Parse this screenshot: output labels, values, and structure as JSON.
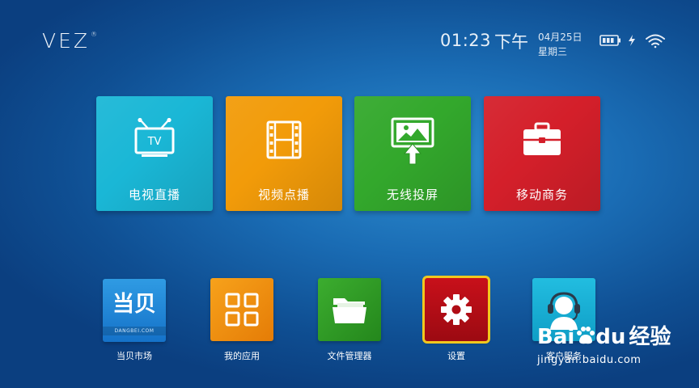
{
  "header": {
    "logo_text": "VEZ",
    "logo_mark": "®",
    "time": "01:23",
    "ampm": "下午",
    "date": "04月25日",
    "weekday": "星期三",
    "status_icons": [
      "battery-icon",
      "charging-icon",
      "wifi-icon"
    ]
  },
  "tiles": [
    {
      "label": "电视直播",
      "icon": "tv-icon",
      "color": "#1ab7d6"
    },
    {
      "label": "视频点播",
      "icon": "film-icon",
      "color": "#f29b09"
    },
    {
      "label": "无线投屏",
      "icon": "screencast-icon",
      "color": "#33a82c"
    },
    {
      "label": "移动商务",
      "icon": "briefcase-icon",
      "color": "#d41f2a"
    }
  ],
  "apps": [
    {
      "label": "当贝市场",
      "icon": "dangbei-icon",
      "badge": "当贝",
      "sub": "DANGBEI.COM"
    },
    {
      "label": "我的应用",
      "icon": "grid-icon"
    },
    {
      "label": "文件管理器",
      "icon": "folder-icon"
    },
    {
      "label": "设置",
      "icon": "gear-icon",
      "focused": true
    },
    {
      "label": "客户服务",
      "icon": "headset-icon"
    }
  ],
  "watermark": {
    "brand": "Bai",
    "brand2": "du",
    "suffix": "经验",
    "url": "jingyan.baidu.com"
  }
}
